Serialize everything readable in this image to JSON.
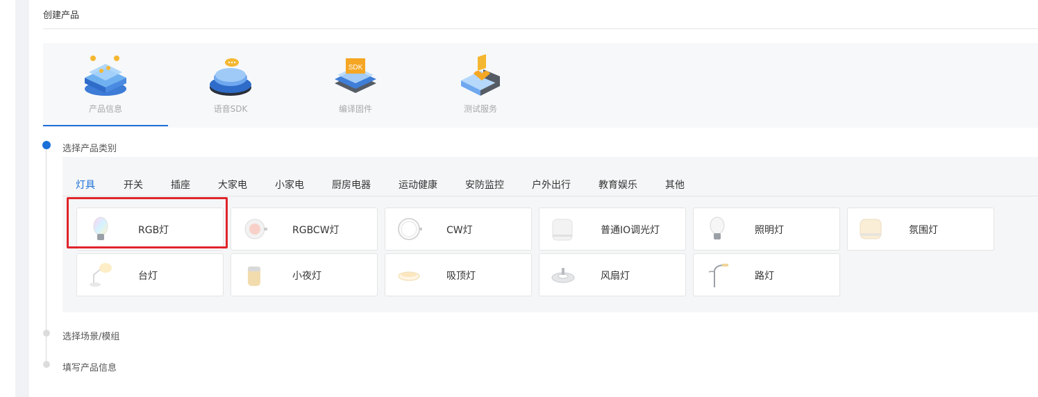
{
  "page": {
    "title": "创建产品"
  },
  "steps": [
    {
      "label": "产品信息",
      "icon": "product-info-icon",
      "active": true
    },
    {
      "label": "语音SDK",
      "icon": "voice-sdk-icon",
      "active": false
    },
    {
      "label": "编译固件",
      "icon": "compile-firmware-icon",
      "active": false
    },
    {
      "label": "测试服务",
      "icon": "test-service-icon",
      "active": false
    }
  ],
  "wizard": {
    "step1": "选择产品类别",
    "step2": "选择场景/模组",
    "step3": "填写产品信息"
  },
  "categories": {
    "tabs": [
      "灯具",
      "开关",
      "插座",
      "大家电",
      "小家电",
      "厨房电器",
      "运动健康",
      "安防监控",
      "户外出行",
      "教育娱乐",
      "其他"
    ],
    "active_tab": "灯具"
  },
  "products": [
    {
      "name": "RGB灯",
      "icon": "rgb-bulb-icon",
      "selected": true
    },
    {
      "name": "RGBCW灯",
      "icon": "rgbcw-light-icon"
    },
    {
      "name": "CW灯",
      "icon": "cw-ring-light-icon"
    },
    {
      "name": "普通IO调光灯",
      "icon": "io-dimmer-light-icon"
    },
    {
      "name": "照明灯",
      "icon": "lighting-bulb-icon"
    },
    {
      "name": "氛围灯",
      "icon": "ambient-light-icon"
    },
    {
      "name": "台灯",
      "icon": "desk-lamp-icon"
    },
    {
      "name": "小夜灯",
      "icon": "night-light-icon"
    },
    {
      "name": "吸顶灯",
      "icon": "ceiling-light-icon"
    },
    {
      "name": "风扇灯",
      "icon": "fan-light-icon"
    },
    {
      "name": "路灯",
      "icon": "street-light-icon"
    }
  ],
  "colors": {
    "accent": "#1a6fd8",
    "selection_outline": "#e0242b"
  }
}
